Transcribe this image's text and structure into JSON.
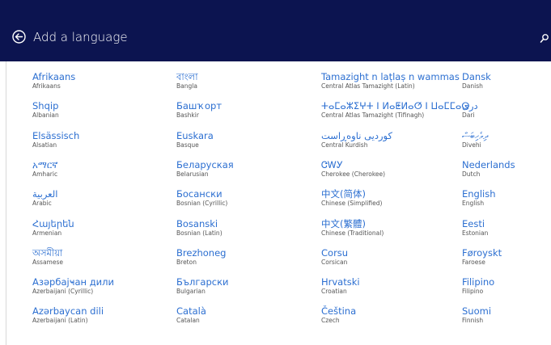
{
  "header": {
    "title": "Add a language"
  },
  "columns": [
    [
      {
        "native": "Afrikaans",
        "english": "Afrikaans"
      },
      {
        "native": "Shqip",
        "english": "Albanian"
      },
      {
        "native": "Elsässisch",
        "english": "Alsatian"
      },
      {
        "native": "አማርኛ",
        "english": "Amharic"
      },
      {
        "native": "العربية",
        "english": "Arabic"
      },
      {
        "native": "Հայերեն",
        "english": "Armenian"
      },
      {
        "native": "অসমীয়া",
        "english": "Assamese"
      },
      {
        "native": "Азәрбајҹан дили",
        "english": "Azerbaijani (Cyrillic)"
      },
      {
        "native": "Azərbaycan dili",
        "english": "Azerbaijani (Latin)"
      }
    ],
    [
      {
        "native": "বাংলা",
        "english": "Bangla"
      },
      {
        "native": "Башҡорт",
        "english": "Bashkir"
      },
      {
        "native": "Euskara",
        "english": "Basque"
      },
      {
        "native": "Беларуская",
        "english": "Belarusian"
      },
      {
        "native": "Босански",
        "english": "Bosnian (Cyrillic)"
      },
      {
        "native": "Bosanski",
        "english": "Bosnian (Latin)"
      },
      {
        "native": "Brezhoneg",
        "english": "Breton"
      },
      {
        "native": "Български",
        "english": "Bulgarian"
      },
      {
        "native": "Català",
        "english": "Catalan"
      }
    ],
    [
      {
        "native": "Tamazight n laṭlaṣ n wammas",
        "english": "Central Atlas Tamazight (Latin)"
      },
      {
        "native": "ⵜⴰⵎⴰⵣⵉⵖⵜ ⵏ ⵍⴰⵟⵍⴰⵚ ⵏ ⵡⴰⵎⵎⴰⵙ",
        "english": "Central Atlas Tamazight (Tifinagh)"
      },
      {
        "native": "کوردیی ناوەڕاست",
        "english": "Central Kurdish"
      },
      {
        "native": "ᏣᎳᎩ",
        "english": "Cherokee (Cherokee)"
      },
      {
        "native": "中文(简体)",
        "english": "Chinese (Simplified)"
      },
      {
        "native": "中文(繁體)",
        "english": "Chinese (Traditional)"
      },
      {
        "native": "Corsu",
        "english": "Corsican"
      },
      {
        "native": "Hrvatski",
        "english": "Croatian"
      },
      {
        "native": "Čeština",
        "english": "Czech"
      }
    ],
    [
      {
        "native": "Dansk",
        "english": "Danish"
      },
      {
        "native": "دری",
        "english": "Dari"
      },
      {
        "native": "ދިވެހިބަސް",
        "english": "Divehi"
      },
      {
        "native": "Nederlands",
        "english": "Dutch"
      },
      {
        "native": "English",
        "english": "English"
      },
      {
        "native": "Eesti",
        "english": "Estonian"
      },
      {
        "native": "Føroyskt",
        "english": "Faroese"
      },
      {
        "native": "Filipino",
        "english": "Filipino"
      },
      {
        "native": "Suomi",
        "english": "Finnish"
      }
    ]
  ],
  "colors": {
    "header_bg": "#0c1450",
    "link": "#2c6fd1",
    "subtext": "#555555"
  },
  "icons": {
    "back": "back-arrow-circle-icon",
    "search": "search-icon"
  }
}
